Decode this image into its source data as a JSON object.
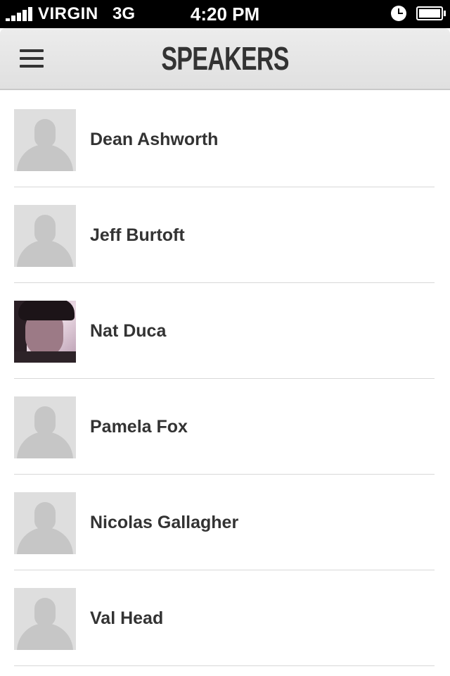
{
  "status_bar": {
    "carrier": "VIRGIN",
    "network": "3G",
    "time": "4:20 PM",
    "signal_bars": 5,
    "battery_level": 0.95,
    "icons": [
      "signal-icon",
      "alarm-icon",
      "battery-icon"
    ]
  },
  "nav": {
    "title": "SPEAKERS",
    "menu_icon": "hamburger-menu-icon"
  },
  "speakers": [
    {
      "name": "Dean Ashworth",
      "avatar": "placeholder"
    },
    {
      "name": "Jeff Burtoft",
      "avatar": "placeholder"
    },
    {
      "name": "Nat Duca",
      "avatar": "photo"
    },
    {
      "name": "Pamela Fox",
      "avatar": "placeholder"
    },
    {
      "name": "Nicolas Gallagher",
      "avatar": "placeholder"
    },
    {
      "name": "Val Head",
      "avatar": "placeholder"
    }
  ],
  "colors": {
    "status_bar_bg": "#000000",
    "nav_bg": "#e4e4e4",
    "text": "#333333",
    "divider": "#d8d8d8",
    "placeholder_bg": "#dedede"
  }
}
